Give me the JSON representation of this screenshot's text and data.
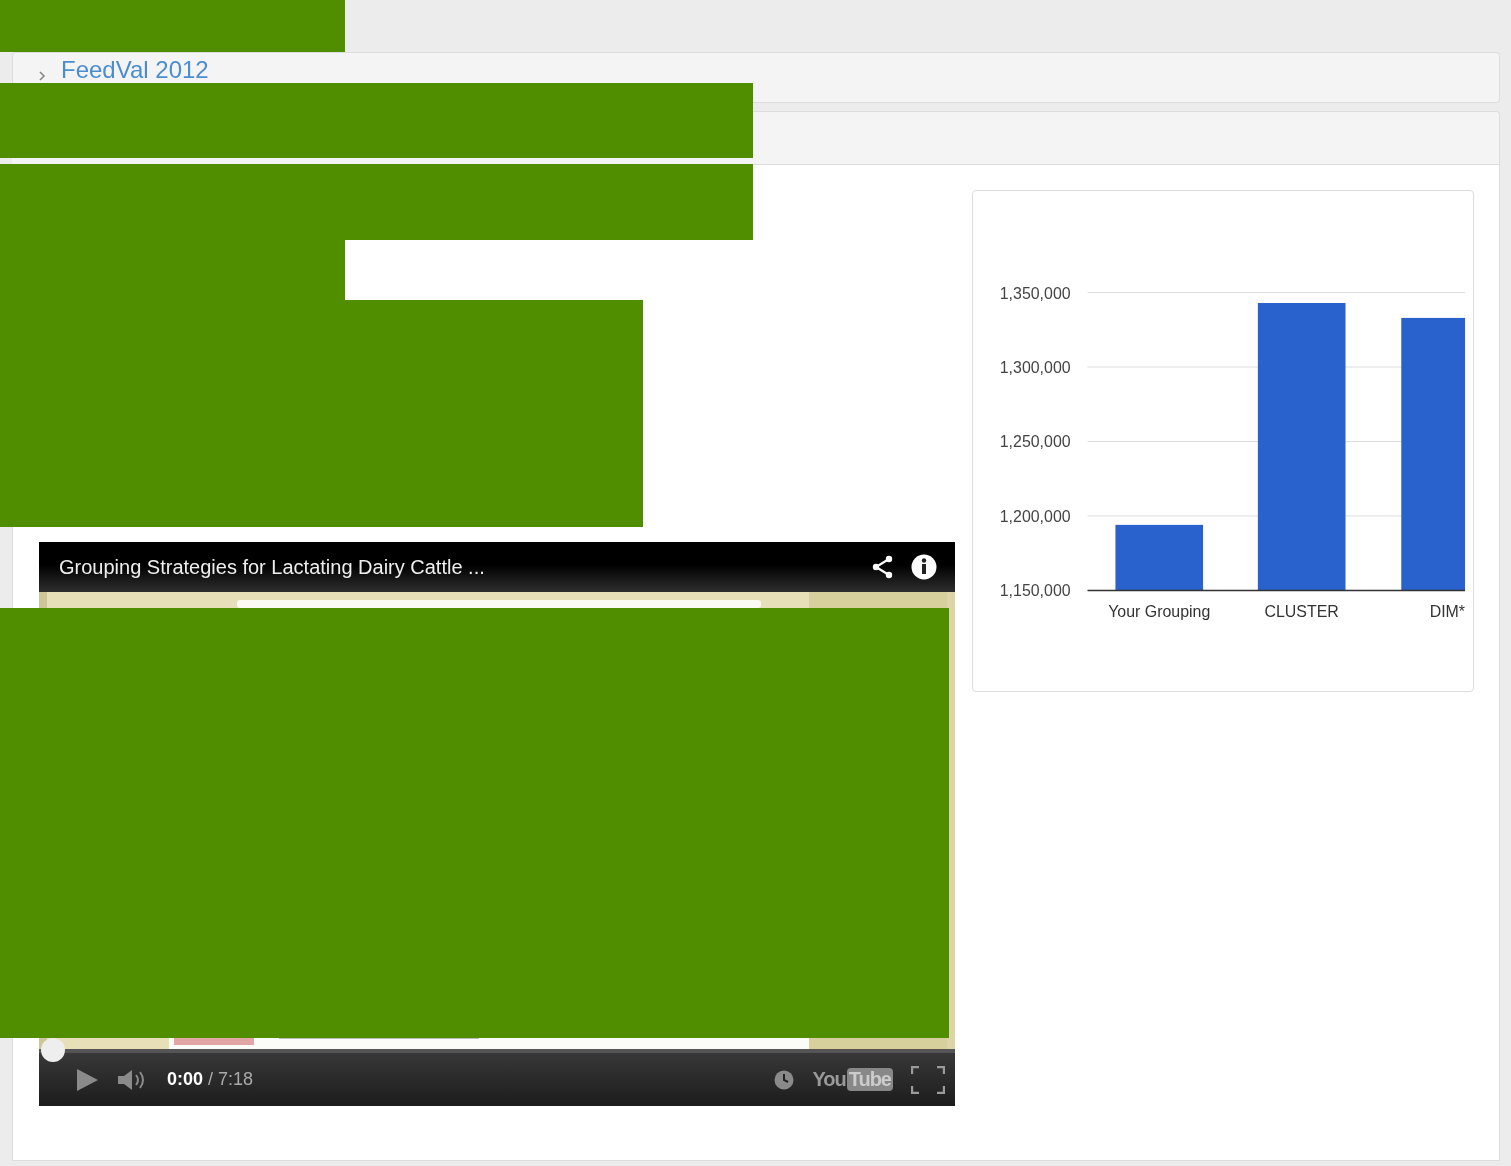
{
  "panels": [
    {
      "title": "FeedVal 2012",
      "expanded": false
    }
  ],
  "video": {
    "title": "Grouping Strategies for Lactating Dairy Cattle ...",
    "current_time": "0:00",
    "duration": "/ 7:18",
    "logo": [
      "You",
      "Tube"
    ],
    "frame": {
      "kind": "picture"
    }
  },
  "chart": {
    "chart_data": {
      "type": "bar",
      "categories": [
        "Your Grouping",
        "CLUSTER",
        "DIM*"
      ],
      "grid": true,
      "series": [
        {
          "color": "#2962cc",
          "values": [
            1194000,
            1343000,
            1333000
          ]
        }
      ],
      "ylim": [
        1150000,
        1350000
      ],
      "yticks": [
        {
          "value": 1150000,
          "label": "1,150,000"
        },
        {
          "value": 1200000,
          "label": "1,200,000"
        },
        {
          "value": 1250000,
          "label": "1,250,000"
        },
        {
          "value": 1300000,
          "label": "1,300,000"
        },
        {
          "value": 1350000,
          "label": "1,350,000"
        }
      ]
    }
  },
  "redactions": [
    {
      "color": "#508e00"
    },
    {
      "color": "#508e00"
    },
    {
      "color": "#508e00"
    },
    {
      "color": "#508e00"
    },
    {
      "color": "#508e00"
    },
    {
      "color": "#508e00"
    }
  ]
}
